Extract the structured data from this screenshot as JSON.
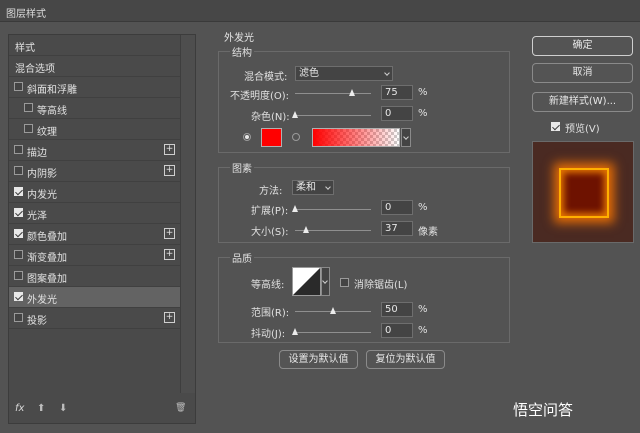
{
  "window": {
    "title": "图层样式"
  },
  "left": {
    "items": [
      {
        "label": "样式",
        "checkbox": false,
        "checked": false,
        "plus": false,
        "indent": false,
        "selected": false
      },
      {
        "label": "混合选项",
        "checkbox": false,
        "checked": false,
        "plus": false,
        "indent": false,
        "selected": false
      },
      {
        "label": "斜面和浮雕",
        "checkbox": true,
        "checked": false,
        "plus": false,
        "indent": false,
        "selected": false
      },
      {
        "label": "等高线",
        "checkbox": true,
        "checked": false,
        "plus": false,
        "indent": true,
        "selected": false
      },
      {
        "label": "纹理",
        "checkbox": true,
        "checked": false,
        "plus": false,
        "indent": true,
        "selected": false
      },
      {
        "label": "描边",
        "checkbox": true,
        "checked": false,
        "plus": true,
        "indent": false,
        "selected": false
      },
      {
        "label": "内阴影",
        "checkbox": true,
        "checked": false,
        "plus": true,
        "indent": false,
        "selected": false
      },
      {
        "label": "内发光",
        "checkbox": true,
        "checked": true,
        "plus": false,
        "indent": false,
        "selected": false
      },
      {
        "label": "光泽",
        "checkbox": true,
        "checked": true,
        "plus": false,
        "indent": false,
        "selected": false
      },
      {
        "label": "颜色叠加",
        "checkbox": true,
        "checked": true,
        "plus": true,
        "indent": false,
        "selected": false
      },
      {
        "label": "渐变叠加",
        "checkbox": true,
        "checked": false,
        "plus": true,
        "indent": false,
        "selected": false
      },
      {
        "label": "图案叠加",
        "checkbox": true,
        "checked": false,
        "plus": false,
        "indent": false,
        "selected": false
      },
      {
        "label": "外发光",
        "checkbox": true,
        "checked": true,
        "plus": false,
        "indent": false,
        "selected": true
      },
      {
        "label": "投影",
        "checkbox": true,
        "checked": false,
        "plus": true,
        "indent": false,
        "selected": false
      }
    ],
    "footer": {
      "fx": "fx",
      "up": "⬆",
      "down": "⬇",
      "trash": "🗑"
    }
  },
  "outer_glow": {
    "title": "外发光",
    "structure": {
      "title": "结构",
      "blend_mode_label": "混合模式:",
      "blend_mode_value": "滤色",
      "opacity_label": "不透明度(O):",
      "opacity_value": "75",
      "opacity_fraction": 0.75,
      "noise_label": "杂色(N):",
      "noise_value": "0",
      "noise_fraction": 0.0,
      "percent": "%",
      "color": "#ff0000"
    },
    "elements": {
      "title": "图素",
      "method_label": "方法:",
      "method_value": "柔和",
      "spread_label": "扩展(P):",
      "spread_value": "0",
      "spread_fraction": 0.0,
      "size_label": "大小(S):",
      "size_value": "37",
      "size_fraction": 0.15,
      "percent": "%",
      "pixel_unit": "像素"
    },
    "quality": {
      "title": "品质",
      "contour_label": "等高线:",
      "antialias_label": "消除锯齿(L)",
      "range_label": "范围(R):",
      "range_value": "50",
      "range_fraction": 0.5,
      "jitter_label": "抖动(J):",
      "jitter_value": "0",
      "jitter_fraction": 0.0,
      "percent": "%"
    },
    "buttons": {
      "make_default": "设置为默认值",
      "reset_default": "复位为默认值"
    }
  },
  "actions": {
    "ok": "确定",
    "cancel": "取消",
    "new_style": "新建样式(W)...",
    "preview_label": "预览(V)",
    "preview_checked": true
  },
  "watermark": "悟空问答"
}
